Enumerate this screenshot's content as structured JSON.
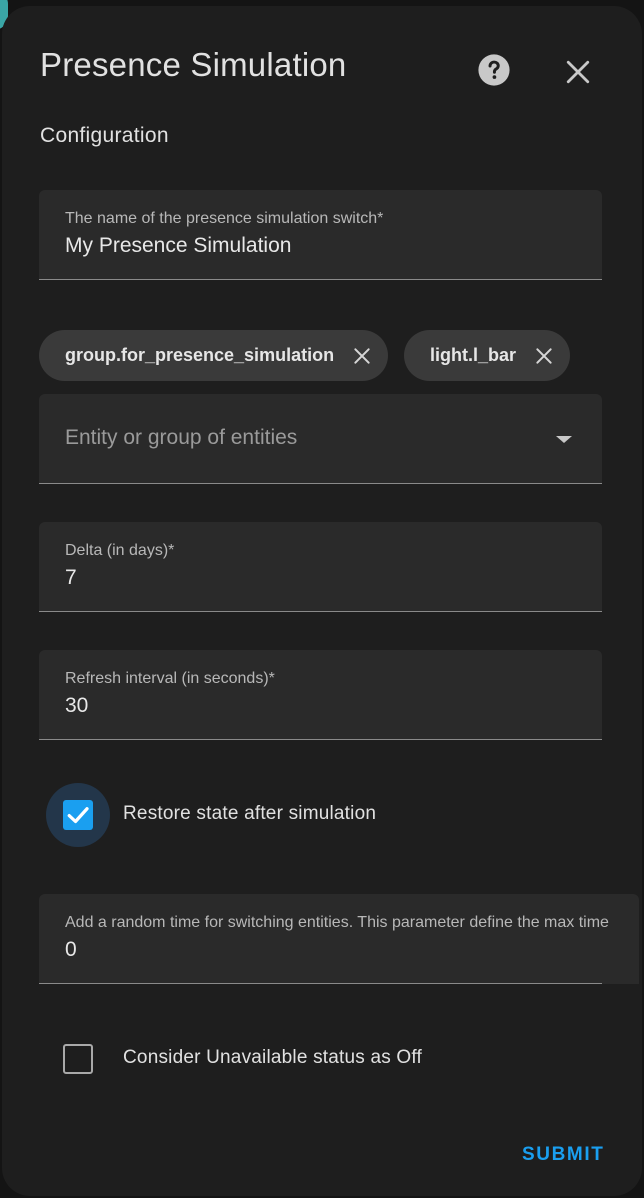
{
  "dialog": {
    "title": "Presence Simulation",
    "help_icon": "help-circle-icon",
    "close_icon": "close-icon",
    "subtitle": "Configuration"
  },
  "fields": {
    "switch_name": {
      "label": "The name of the presence simulation switch*",
      "value": "My Presence Simulation"
    },
    "entities": {
      "chips": [
        {
          "label": "group.for_presence_simulation"
        },
        {
          "label": "light.l_bar"
        }
      ],
      "placeholder": "Entity or group of entities"
    },
    "delta": {
      "label": "Delta (in days)*",
      "value": "7"
    },
    "refresh_interval": {
      "label": "Refresh interval (in seconds)*",
      "value": "30"
    },
    "restore_state": {
      "label": "Restore state after simulation",
      "checked": true
    },
    "random_time": {
      "label": "Add a random time for switching entities. This parameter define the max time",
      "value": "0"
    },
    "unavailable_as_off": {
      "label": "Consider Unavailable status as Off",
      "checked": false
    }
  },
  "actions": {
    "submit_label": "SUBMIT"
  },
  "colors": {
    "accent": "#1a9ff0",
    "surface": "#1e1e1e",
    "field_bg": "#2a2a2a",
    "chip_bg": "#3a3a3a"
  }
}
